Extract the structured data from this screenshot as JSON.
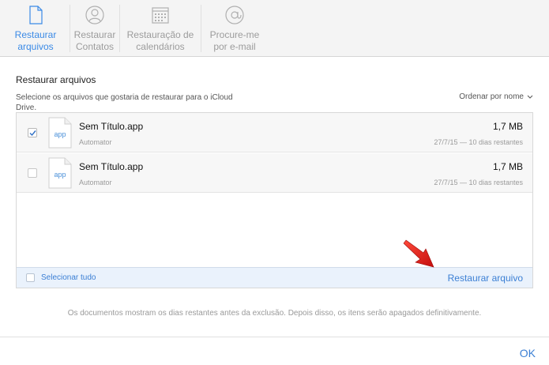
{
  "tabs": [
    {
      "label": "Restaurar\narquivos",
      "icon": "document-icon",
      "active": true
    },
    {
      "label": "Restaurar\nContatos",
      "icon": "contacts-icon",
      "active": false
    },
    {
      "label": "Restauração de\ncalendários",
      "icon": "calendar-icon",
      "active": false
    },
    {
      "label": "Procure-me\npor e-mail",
      "icon": "at-sign-icon",
      "active": false
    }
  ],
  "section": {
    "title": "Restaurar arquivos",
    "description": "Selecione os arquivos que gostaria de restaurar para o iCloud Drive.",
    "sort_label": "Ordenar por nome"
  },
  "files": [
    {
      "icon_text": "app",
      "name": "Sem Título.app",
      "app": "Automator",
      "size": "1,7 MB",
      "date": "27/7/15 — 10 dias restantes",
      "checked": true
    },
    {
      "icon_text": "app",
      "name": "Sem Título.app",
      "app": "Automator",
      "size": "1,7 MB",
      "date": "27/7/15 — 10 dias restantes",
      "checked": false
    }
  ],
  "footer": {
    "select_all": "Selecionar tudo",
    "restore": "Restaurar arquivo"
  },
  "footnote": "Os documentos mostram os dias restantes antes da exclusão. Depois disso, os itens serão apagados definitivamente.",
  "ok": "OK",
  "colors": {
    "accent": "#3b7fd4",
    "arrow": "#e21a1a"
  }
}
